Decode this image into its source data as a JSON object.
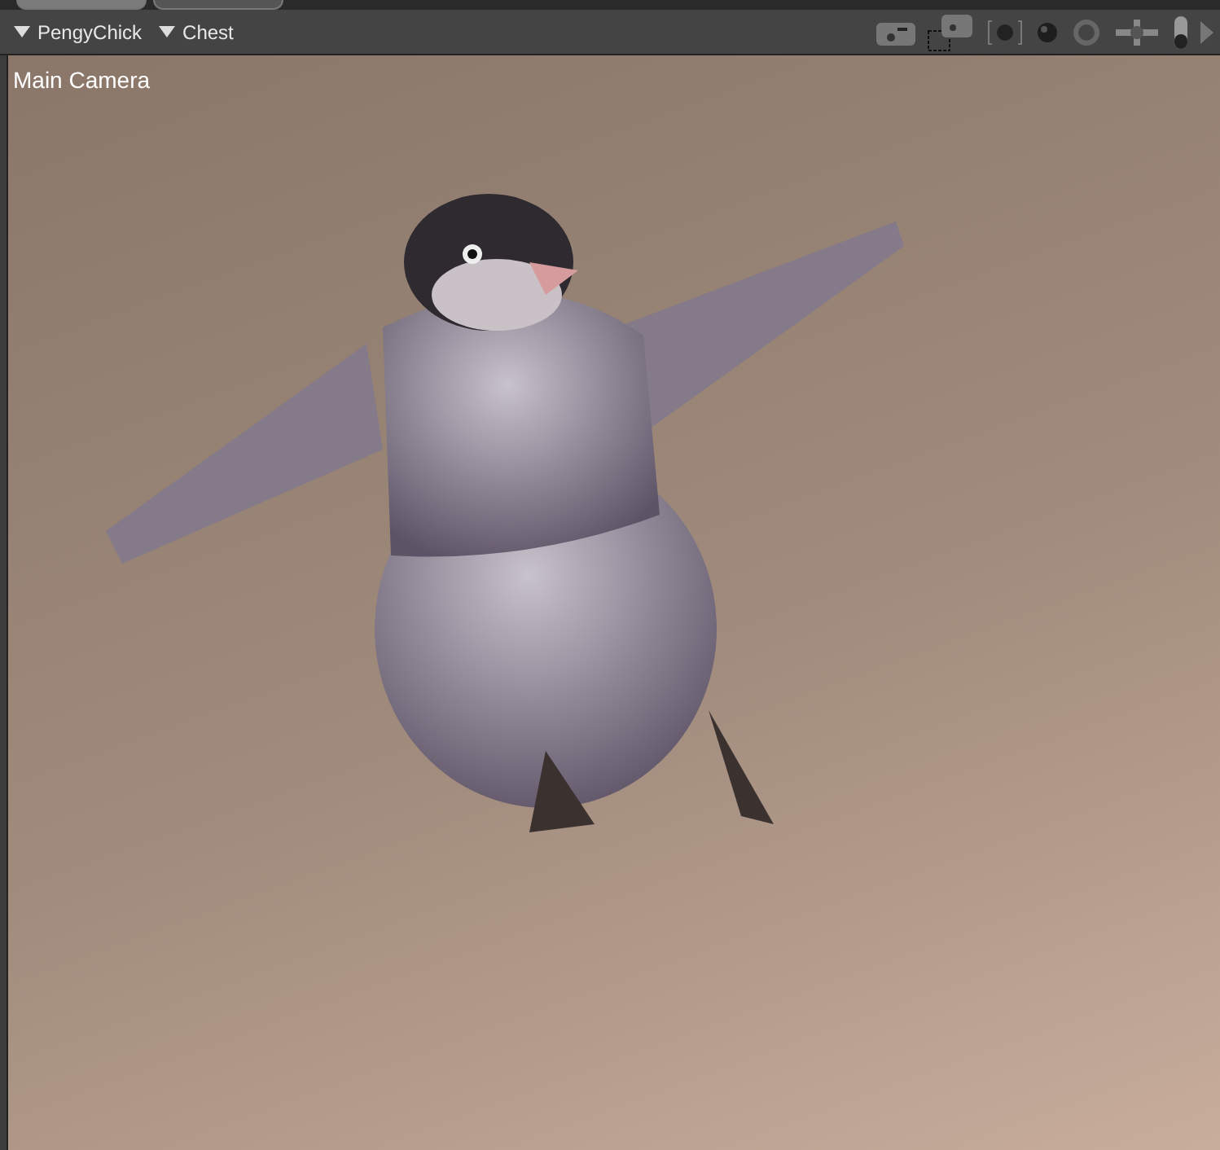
{
  "tabs": [
    {
      "selected": true
    },
    {
      "selected": false
    }
  ],
  "toolbar": {
    "menus": [
      {
        "label": "PengyChick"
      },
      {
        "label": "Chest"
      }
    ]
  },
  "viewport": {
    "camera_label": "Main Camera"
  }
}
